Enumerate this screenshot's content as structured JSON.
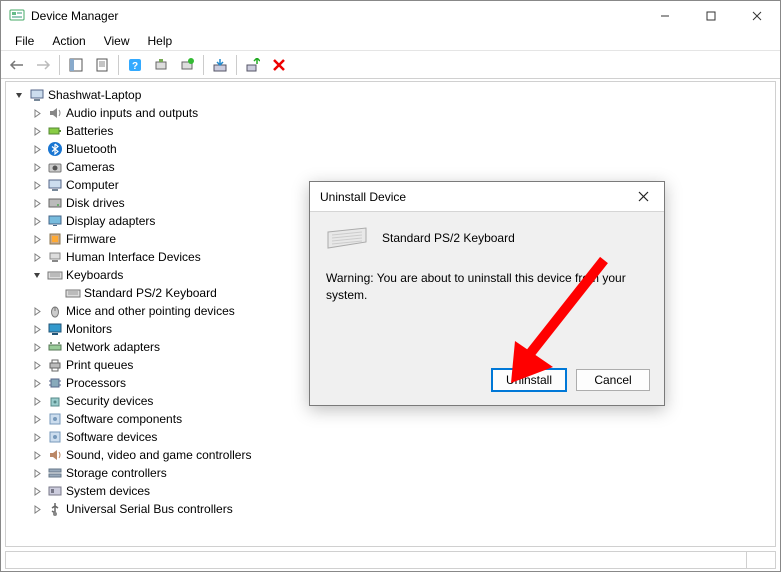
{
  "window": {
    "title": "Device Manager"
  },
  "menubar": [
    "File",
    "Action",
    "View",
    "Help"
  ],
  "toolbar_icons": [
    "back-icon",
    "forward-icon",
    "sep",
    "show-hidden-icon",
    "properties-icon",
    "sep",
    "help-icon",
    "refresh-icon",
    "enable-icon",
    "sep",
    "update-driver-icon",
    "sep",
    "uninstall-icon",
    "sep",
    "delete-icon"
  ],
  "tree": {
    "root": {
      "label": "Shashwat-Laptop",
      "expanded": true,
      "icon": "computer"
    },
    "nodes": [
      {
        "label": "Audio inputs and outputs",
        "icon": "audio",
        "expanded": false
      },
      {
        "label": "Batteries",
        "icon": "battery",
        "expanded": false
      },
      {
        "label": "Bluetooth",
        "icon": "bluetooth",
        "expanded": false
      },
      {
        "label": "Cameras",
        "icon": "camera",
        "expanded": false
      },
      {
        "label": "Computer",
        "icon": "computer",
        "expanded": false
      },
      {
        "label": "Disk drives",
        "icon": "disk",
        "expanded": false
      },
      {
        "label": "Display adapters",
        "icon": "display",
        "expanded": false
      },
      {
        "label": "Firmware",
        "icon": "firmware",
        "expanded": false
      },
      {
        "label": "Human Interface Devices",
        "icon": "hid",
        "expanded": false
      },
      {
        "label": "Keyboards",
        "icon": "keyboard",
        "expanded": true,
        "children": [
          {
            "label": "Standard PS/2 Keyboard",
            "icon": "keyboard"
          }
        ]
      },
      {
        "label": "Mice and other pointing devices",
        "icon": "mouse",
        "expanded": false
      },
      {
        "label": "Monitors",
        "icon": "monitor",
        "expanded": false
      },
      {
        "label": "Network adapters",
        "icon": "network",
        "expanded": false
      },
      {
        "label": "Print queues",
        "icon": "printer",
        "expanded": false
      },
      {
        "label": "Processors",
        "icon": "cpu",
        "expanded": false
      },
      {
        "label": "Security devices",
        "icon": "security",
        "expanded": false
      },
      {
        "label": "Software components",
        "icon": "software",
        "expanded": false
      },
      {
        "label": "Software devices",
        "icon": "software",
        "expanded": false
      },
      {
        "label": "Sound, video and game controllers",
        "icon": "sound",
        "expanded": false
      },
      {
        "label": "Storage controllers",
        "icon": "storage",
        "expanded": false
      },
      {
        "label": "System devices",
        "icon": "system",
        "expanded": false
      },
      {
        "label": "Universal Serial Bus controllers",
        "icon": "usb",
        "expanded": false
      }
    ]
  },
  "dialog": {
    "title": "Uninstall Device",
    "device_name": "Standard PS/2 Keyboard",
    "warning": "Warning: You are about to uninstall this device from your system.",
    "primary_button": "Uninstall",
    "secondary_button": "Cancel"
  }
}
